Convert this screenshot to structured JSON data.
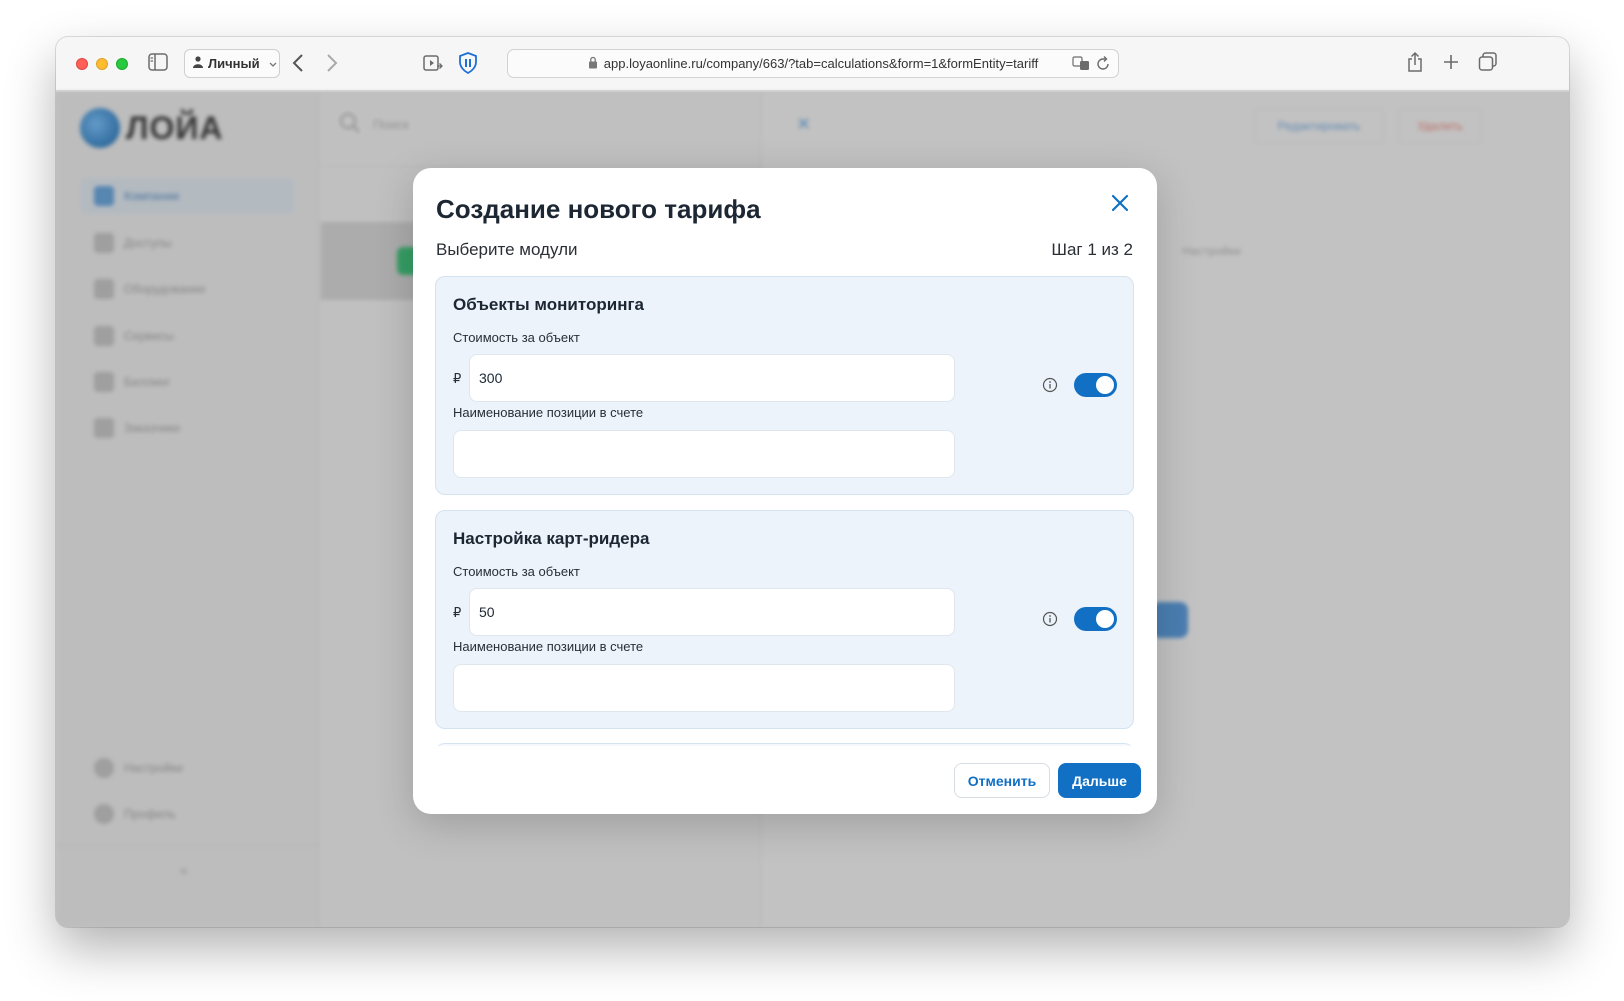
{
  "browser": {
    "profile_label": "Личный",
    "url": "app.loyaonline.ru/company/663/?tab=calculations&form=1&formEntity=tariff"
  },
  "background": {
    "logo_text": "ЛОЙА",
    "search_placeholder": "Поиск",
    "sidebar_items": [
      {
        "label": "Компании",
        "active": true
      },
      {
        "label": "Доступы"
      },
      {
        "label": "Оборудование"
      },
      {
        "label": "Сервисы"
      },
      {
        "label": "Биллинг"
      },
      {
        "label": "Заказчики"
      }
    ],
    "sidebar_bottom": [
      {
        "label": "Настройки"
      },
      {
        "label": "Профиль"
      }
    ],
    "right_panel": {
      "edit_label": "Редактировать",
      "delete_label": "Удалить",
      "tab_label": "Настройки"
    }
  },
  "modal": {
    "title": "Создание нового тарифа",
    "subtitle": "Выберите модули",
    "step": "Шаг 1 из 2",
    "cards": [
      {
        "title": "Объекты мониторинга",
        "price_label": "Стоимость за объект",
        "currency": "₽",
        "price_value": "300",
        "position_label": "Наименование позиции в счете",
        "position_value": "",
        "enabled": true
      },
      {
        "title": "Настройка карт-ридера",
        "price_label": "Стоимость за объект",
        "currency": "₽",
        "price_value": "50",
        "position_label": "Наименование позиции в счете",
        "position_value": "",
        "enabled": true
      }
    ],
    "cancel_label": "Отменить",
    "next_label": "Дальше"
  },
  "colors": {
    "accent": "#1170c4",
    "card_bg": "#ecf3fb",
    "title_text": "#1c2733"
  },
  "icons": [
    "sidebar-toggle-icon",
    "person-icon",
    "back-arrow-icon",
    "forward-arrow-icon",
    "reader-icon",
    "privacy-shield-icon",
    "lock-icon",
    "translate-icon",
    "reload-icon",
    "share-icon",
    "new-tab-icon",
    "tab-overview-icon",
    "close-icon",
    "info-icon"
  ]
}
